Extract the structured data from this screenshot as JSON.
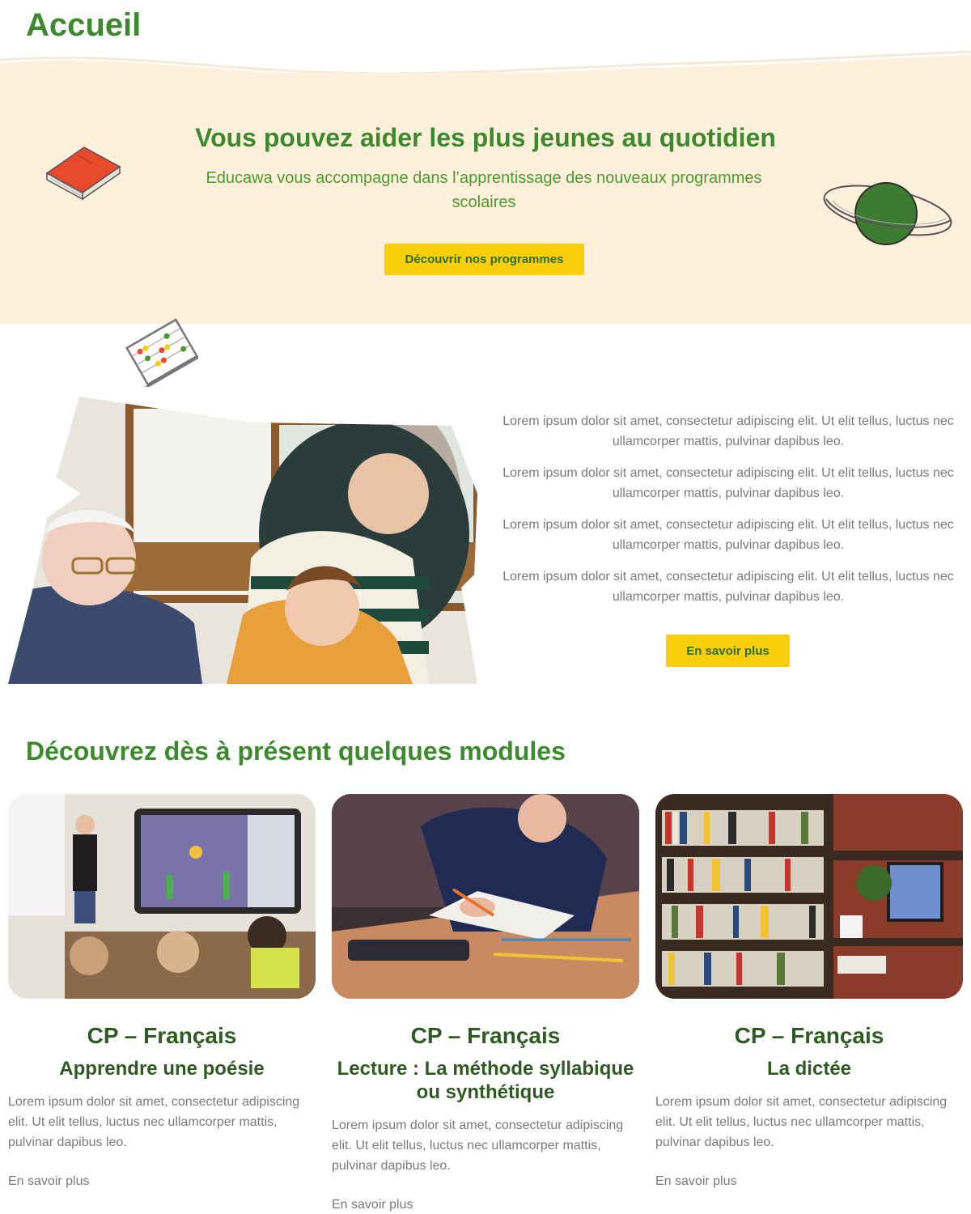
{
  "page": {
    "title": "Accueil"
  },
  "hero": {
    "heading": "Vous pouvez aider les plus jeunes au quotidien",
    "subheading": "Educawa vous accompagne dans l’apprentissage des nouveaux programmes scolaires",
    "cta_label": "Découvrir nos programmes",
    "bg_color": "#fff0dc",
    "accent_color": "#3d8a2e",
    "button_color": "#f7cf0a"
  },
  "decorations": {
    "book": "book-icon",
    "planet": "planet-icon",
    "abacus": "abacus-icon"
  },
  "intro": {
    "image": "grandparents-helping-child-photo",
    "paragraphs": [
      "Lorem ipsum dolor sit amet, consectetur adipiscing elit. Ut elit tellus, luctus nec ullamcorper mattis, pulvinar dapibus leo.",
      "Lorem ipsum dolor sit amet, consectetur adipiscing elit. Ut elit tellus, luctus nec ullamcorper mattis, pulvinar dapibus leo.",
      "Lorem ipsum dolor sit amet, consectetur adipiscing elit. Ut elit tellus, luctus nec ullamcorper mattis, pulvinar dapibus leo.",
      "Lorem ipsum dolor sit amet, consectetur adipiscing elit. Ut elit tellus, luctus nec ullamcorper mattis, pulvinar dapibus leo."
    ],
    "cta_label": "En savoir plus"
  },
  "modules": {
    "heading": "Découvrez dès à présent quelques modules",
    "items": [
      {
        "image": "classroom-screen-photo",
        "level": "CP – Français",
        "title": "Apprendre une poésie",
        "description": "Lorem ipsum dolor sit amet, consectetur adipiscing elit. Ut elit tellus, luctus nec ullamcorper mattis, pulvinar dapibus leo.",
        "link_label": "En savoir plus"
      },
      {
        "image": "child-drawing-photo",
        "level": "CP – Français",
        "title": "Lecture : La méthode syllabique ou synthétique",
        "description": "Lorem ipsum dolor sit amet, consectetur adipiscing elit. Ut elit tellus, luctus nec ullamcorper mattis, pulvinar dapibus leo.",
        "link_label": "En savoir plus"
      },
      {
        "image": "bookshelf-photo",
        "level": "CP – Français",
        "title": "La dictée",
        "description": "Lorem ipsum dolor sit amet, consectetur adipiscing elit. Ut elit tellus, luctus nec ullamcorper mattis, pulvinar dapibus leo.",
        "link_label": "En savoir plus"
      }
    ]
  }
}
